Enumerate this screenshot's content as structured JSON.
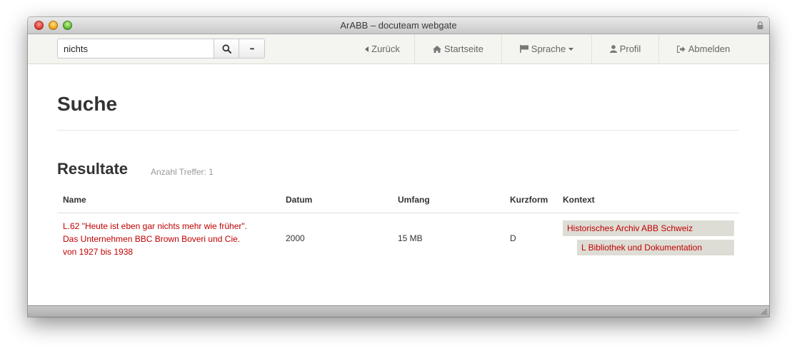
{
  "window": {
    "title": "ArABB – docuteam webgate"
  },
  "search": {
    "value": "nichts",
    "more_label": "•••"
  },
  "nav": {
    "back": "Zurück",
    "home": "Startseite",
    "language": "Sprache",
    "profile": "Profil",
    "logout": "Abmelden"
  },
  "page": {
    "title": "Suche"
  },
  "results": {
    "title": "Resultate",
    "count_label": "Anzahl Treffer: 1",
    "columns": [
      "Name",
      "Datum",
      "Umfang",
      "Kurzform",
      "Kontext"
    ],
    "rows": [
      {
        "name": "L.62 \"Heute ist eben gar nichts mehr wie früher\". Das Unternehmen BBC Brown Boveri und Cie. von 1927 bis 1938",
        "datum": "2000",
        "umfang": "15 MB",
        "kurzform": "D",
        "kontext": [
          "Historisches Archiv ABB Schweiz",
          "L Bibliothek und Dokumentation"
        ]
      }
    ]
  },
  "colors": {
    "link": "#c00000",
    "context_bg": "#deddd5",
    "navbar_bg": "#f4f4f0"
  }
}
